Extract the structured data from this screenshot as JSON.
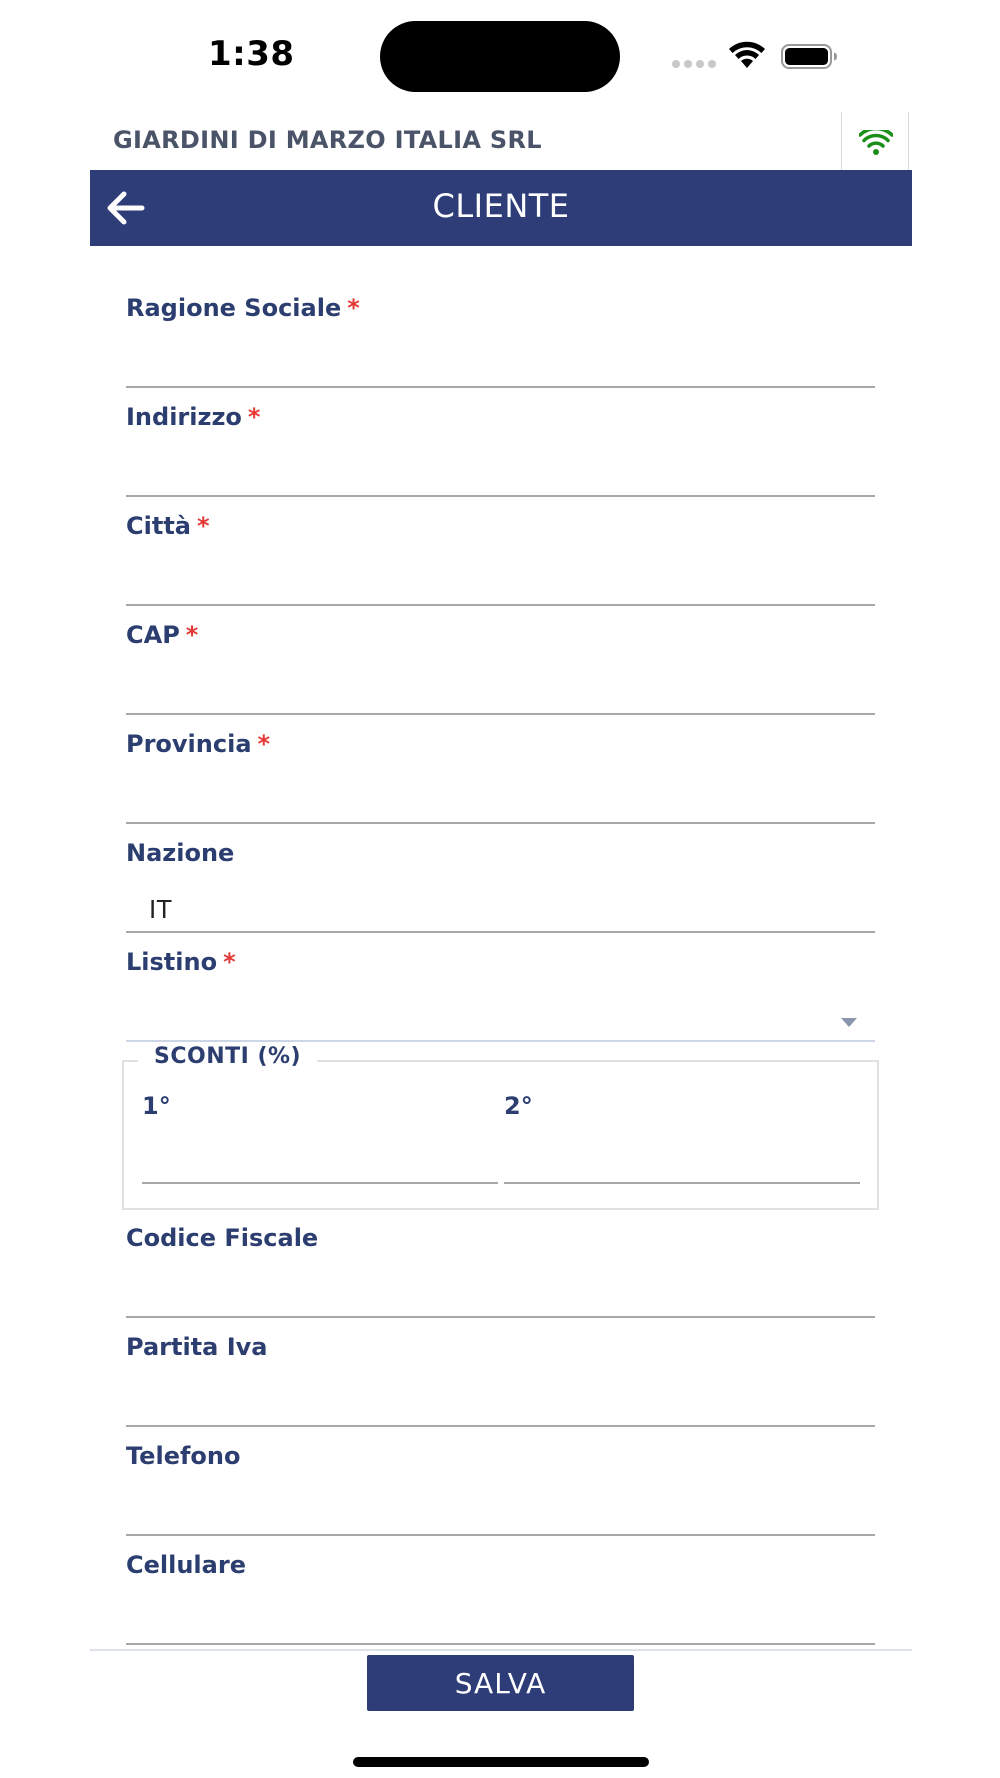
{
  "status_bar": {
    "time": "1:38"
  },
  "header": {
    "company": "GIARDINI DI MARZO ITALIA SRL",
    "title": "CLIENTE",
    "connection_icon": "wifi-icon",
    "connection_color": "#1a8f1a",
    "back_icon": "arrow-left-icon"
  },
  "form": {
    "required_marker": "*",
    "fields": [
      {
        "label": "Ragione Sociale",
        "required": true,
        "value": ""
      },
      {
        "label": "Indirizzo",
        "required": true,
        "value": ""
      },
      {
        "label": "Città",
        "required": true,
        "value": ""
      },
      {
        "label": "CAP",
        "required": true,
        "value": ""
      },
      {
        "label": "Provincia",
        "required": true,
        "value": ""
      },
      {
        "label": "Nazione",
        "required": false,
        "value": "IT"
      },
      {
        "label": "Listino",
        "required": true,
        "value": ""
      }
    ],
    "sconti": {
      "legend": "SCONTI (%)",
      "fields": [
        {
          "label": "1°",
          "value": ""
        },
        {
          "label": "2°",
          "value": ""
        }
      ]
    },
    "extra_fields": [
      {
        "label": "Codice Fiscale",
        "value": ""
      },
      {
        "label": "Partita Iva",
        "value": ""
      },
      {
        "label": "Telefono",
        "value": ""
      },
      {
        "label": "Cellulare",
        "value": ""
      }
    ]
  },
  "footer": {
    "save_label": "SALVA"
  },
  "colors": {
    "primary": "#2e3d78",
    "label": "#2c3e70",
    "required": "#e53935"
  }
}
